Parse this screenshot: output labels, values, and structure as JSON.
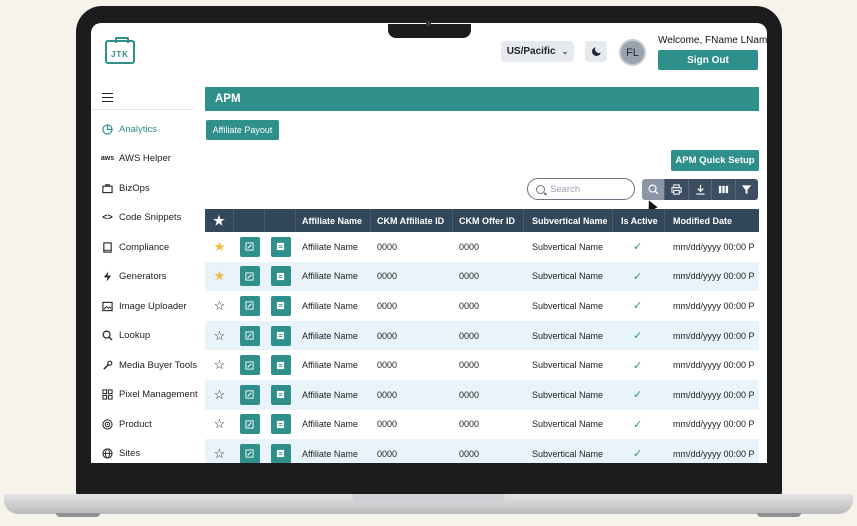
{
  "header": {
    "logo_text": "JTK",
    "timezone": "US/Pacific",
    "avatar_initials": "FL",
    "welcome": "Welcome, FName LName",
    "sign_out": "Sign Out"
  },
  "sidebar": {
    "items": [
      {
        "label": "Analytics",
        "icon": "pie-chart-icon",
        "active": true
      },
      {
        "label": "AWS Helper",
        "icon": "aws-icon"
      },
      {
        "label": "BizOps",
        "icon": "briefcase-icon"
      },
      {
        "label": "Code Snippets",
        "icon": "code-icon"
      },
      {
        "label": "Compliance",
        "icon": "book-icon"
      },
      {
        "label": "Generators",
        "icon": "bolt-icon"
      },
      {
        "label": "Image Uploader",
        "icon": "image-icon"
      },
      {
        "label": "Lookup",
        "icon": "search-icon"
      },
      {
        "label": "Media Buyer Tools",
        "icon": "wrench-icon"
      },
      {
        "label": "Pixel Management",
        "icon": "grid-icon"
      },
      {
        "label": "Product",
        "icon": "target-icon"
      },
      {
        "label": "Sites",
        "icon": "globe-icon"
      }
    ]
  },
  "main": {
    "title": "APM",
    "tab": "Affiliate Payout",
    "quick_setup": "APM Quick Setup",
    "search_placeholder": "Search",
    "toolbar": [
      "search-icon",
      "print-icon",
      "download-icon",
      "columns-icon",
      "filter-icon"
    ]
  },
  "table": {
    "columns": [
      "Affiliate Name",
      "CKM Affiliate ID",
      "CKM Offer ID",
      "Subvertical Name",
      "Is Active",
      "Modified Date"
    ],
    "rows": [
      {
        "fav": true,
        "name": "Affiliate Name",
        "aff_id": "0000",
        "offer_id": "0000",
        "sub": "Subvertical Name",
        "active": "✓",
        "modified": "mm/dd/yyyy 00:00 P"
      },
      {
        "fav": true,
        "name": "Affiliate Name",
        "aff_id": "0000",
        "offer_id": "0000",
        "sub": "Subvertical Name",
        "active": "✓",
        "modified": "mm/dd/yyyy 00:00 P"
      },
      {
        "fav": false,
        "name": "Affiliate Name",
        "aff_id": "0000",
        "offer_id": "0000",
        "sub": "Subvertical Name",
        "active": "✓",
        "modified": "mm/dd/yyyy 00:00 P"
      },
      {
        "fav": false,
        "name": "Affiliate Name",
        "aff_id": "0000",
        "offer_id": "0000",
        "sub": "Subvertical Name",
        "active": "✓",
        "modified": "mm/dd/yyyy 00:00 P"
      },
      {
        "fav": false,
        "name": "Affiliate Name",
        "aff_id": "0000",
        "offer_id": "0000",
        "sub": "Subvertical Name",
        "active": "✓",
        "modified": "mm/dd/yyyy 00:00 P"
      },
      {
        "fav": false,
        "name": "Affiliate Name",
        "aff_id": "0000",
        "offer_id": "0000",
        "sub": "Subvertical Name",
        "active": "✓",
        "modified": "mm/dd/yyyy 00:00 P"
      },
      {
        "fav": false,
        "name": "Affiliate Name",
        "aff_id": "0000",
        "offer_id": "0000",
        "sub": "Subvertical Name",
        "active": "✓",
        "modified": "mm/dd/yyyy 00:00 P"
      },
      {
        "fav": false,
        "name": "Affiliate Name",
        "aff_id": "0000",
        "offer_id": "0000",
        "sub": "Subvertical Name",
        "active": "✓",
        "modified": "mm/dd/yyyy 00:00 P"
      }
    ]
  },
  "colors": {
    "accent": "#2e8f8b",
    "table_header": "#33475b",
    "row_alt": "#e8f4fa",
    "favorite_star": "#f2b93b"
  }
}
